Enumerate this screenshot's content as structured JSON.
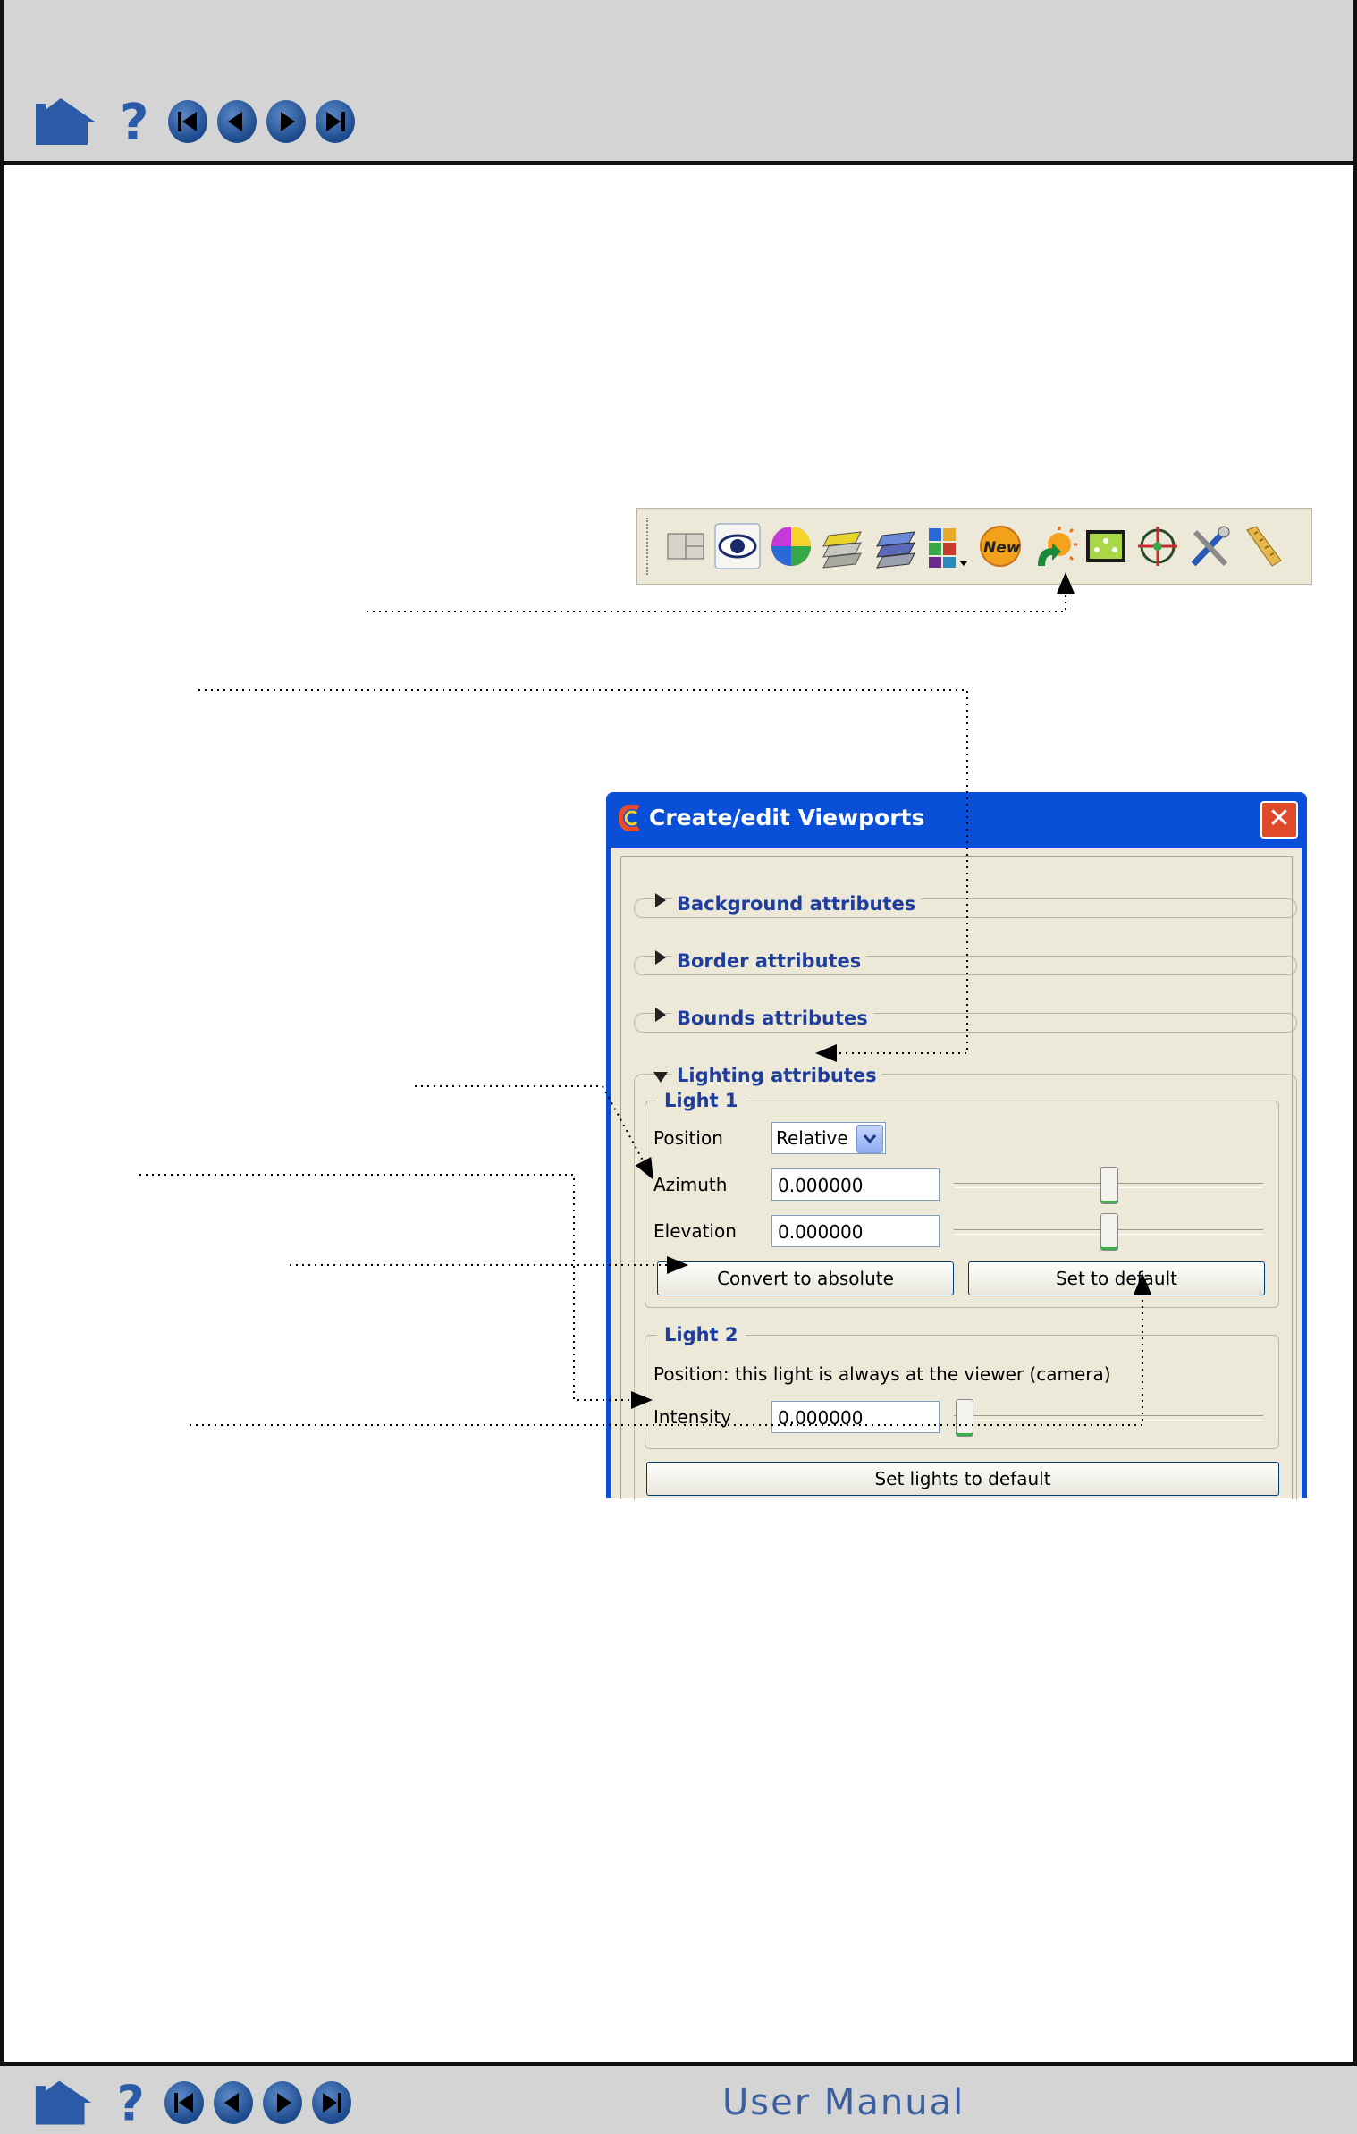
{
  "footer": {
    "title": "User Manual"
  },
  "dialog": {
    "title": "Create/edit Viewports",
    "close_label": "✕",
    "sections": {
      "background": "Background attributes",
      "border": "Border attributes",
      "bounds": "Bounds attributes",
      "lighting": "Lighting attributes"
    },
    "light1": {
      "legend": "Light 1",
      "position_label": "Position",
      "position_value": "Relative",
      "azimuth_label": "Azimuth",
      "azimuth_value": "0.000000",
      "azimuth_slider": 0.5,
      "elevation_label": "Elevation",
      "elevation_value": "0.000000",
      "elevation_slider": 0.5,
      "convert_button": "Convert to absolute",
      "default_button": "Set to default"
    },
    "light2": {
      "legend": "Light 2",
      "position_text": "Position: this light is always at the viewer (camera)",
      "intensity_label": "Intensity",
      "intensity_value": "0.000000",
      "intensity_slider": 0.0
    },
    "set_lights_button": "Set lights to default"
  },
  "toolbar": {
    "icons": [
      "viewport-layout-icon",
      "eye-icon",
      "color-wheel-icon",
      "layers-yellow-icon",
      "layers-blue-icon",
      "grid-palette-icon",
      "new-badge-icon",
      "lighting-icon",
      "frame-icon",
      "target-icon",
      "tools-icon",
      "ruler-icon"
    ]
  },
  "colors": {
    "title_bar": "#0a4fd8",
    "section_text": "#1f3d9c",
    "dialog_bg": "#ece9d8"
  }
}
